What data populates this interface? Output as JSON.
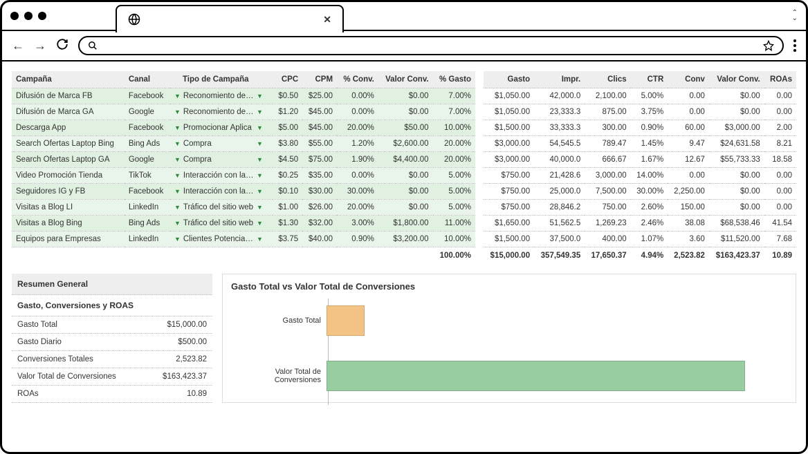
{
  "table1": {
    "headers": [
      "Campaña",
      "Canal",
      "Tipo de Campaña",
      "CPC",
      "CPM",
      "% Conv.",
      "Valor Conv.",
      "% Gasto"
    ],
    "rows": [
      {
        "campana": "Difusión de Marca FB",
        "canal": "Facebook",
        "tipo": "Reconomiento de M",
        "cpc": "$0.50",
        "cpm": "$25.00",
        "pconv": "0.00%",
        "vconv": "$0.00",
        "pgasto": "7.00%"
      },
      {
        "campana": "Difusión de Marca GA",
        "canal": "Google",
        "tipo": "Reconomiento de M",
        "cpc": "$1.20",
        "cpm": "$45.00",
        "pconv": "0.00%",
        "vconv": "$0.00",
        "pgasto": "7.00%"
      },
      {
        "campana": "Descarga App",
        "canal": "Facebook",
        "tipo": "Promocionar Aplica",
        "cpc": "$5.00",
        "cpm": "$45.00",
        "pconv": "20.00%",
        "vconv": "$50.00",
        "pgasto": "10.00%"
      },
      {
        "campana": "Search Ofertas Laptop Bing",
        "canal": "Bing Ads",
        "tipo": "Compra",
        "cpc": "$3.80",
        "cpm": "$55.00",
        "pconv": "1.20%",
        "vconv": "$2,600.00",
        "pgasto": "20.00%"
      },
      {
        "campana": "Search Ofertas Laptop GA",
        "canal": "Google",
        "tipo": "Compra",
        "cpc": "$4.50",
        "cpm": "$75.00",
        "pconv": "1.90%",
        "vconv": "$4,400.00",
        "pgasto": "20.00%"
      },
      {
        "campana": "Video Promoción Tienda",
        "canal": "TikTok",
        "tipo": "Interacción con la Pu",
        "cpc": "$0.25",
        "cpm": "$35.00",
        "pconv": "0.00%",
        "vconv": "$0.00",
        "pgasto": "5.00%"
      },
      {
        "campana": "Seguidores IG y FB",
        "canal": "Facebook",
        "tipo": "Interacción con la Pu",
        "cpc": "$0.10",
        "cpm": "$30.00",
        "pconv": "30.00%",
        "vconv": "$0.00",
        "pgasto": "5.00%"
      },
      {
        "campana": "Visitas a Blog LI",
        "canal": "LinkedIn",
        "tipo": "Tráfico del sitio web",
        "cpc": "$1.00",
        "cpm": "$26.00",
        "pconv": "20.00%",
        "vconv": "$0.00",
        "pgasto": "5.00%"
      },
      {
        "campana": "Visitas a Blog Bing",
        "canal": "Bing Ads",
        "tipo": "Tráfico del sitio web",
        "cpc": "$1.30",
        "cpm": "$32.00",
        "pconv": "3.00%",
        "vconv": "$1,800.00",
        "pgasto": "11.00%"
      },
      {
        "campana": "Equipos para Empresas",
        "canal": "LinkedIn",
        "tipo": "Clientes Potenciales",
        "cpc": "$3.75",
        "cpm": "$40.00",
        "pconv": "0.90%",
        "vconv": "$3,200.00",
        "pgasto": "10.00%"
      }
    ],
    "footer_pgasto": "100.00%"
  },
  "table2": {
    "headers": [
      "Gasto",
      "Impr.",
      "Clics",
      "CTR",
      "Conv",
      "Valor Conv.",
      "ROAs"
    ],
    "rows": [
      {
        "gasto": "$1,050.00",
        "impr": "42,000.0",
        "clics": "2,100.00",
        "ctr": "5.00%",
        "conv": "0.00",
        "vconv": "$0.00",
        "roas": "0.00"
      },
      {
        "gasto": "$1,050.00",
        "impr": "23,333.3",
        "clics": "875.00",
        "ctr": "3.75%",
        "conv": "0.00",
        "vconv": "$0.00",
        "roas": "0.00"
      },
      {
        "gasto": "$1,500.00",
        "impr": "33,333.3",
        "clics": "300.00",
        "ctr": "0.90%",
        "conv": "60.00",
        "vconv": "$3,000.00",
        "roas": "2.00"
      },
      {
        "gasto": "$3,000.00",
        "impr": "54,545.5",
        "clics": "789.47",
        "ctr": "1.45%",
        "conv": "9.47",
        "vconv": "$24,631.58",
        "roas": "8.21"
      },
      {
        "gasto": "$3,000.00",
        "impr": "40,000.0",
        "clics": "666.67",
        "ctr": "1.67%",
        "conv": "12.67",
        "vconv": "$55,733.33",
        "roas": "18.58"
      },
      {
        "gasto": "$750.00",
        "impr": "21,428.6",
        "clics": "3,000.00",
        "ctr": "14.00%",
        "conv": "0.00",
        "vconv": "$0.00",
        "roas": "0.00"
      },
      {
        "gasto": "$750.00",
        "impr": "25,000.0",
        "clics": "7,500.00",
        "ctr": "30.00%",
        "conv": "2,250.00",
        "vconv": "$0.00",
        "roas": "0.00"
      },
      {
        "gasto": "$750.00",
        "impr": "28,846.2",
        "clics": "750.00",
        "ctr": "2.60%",
        "conv": "150.00",
        "vconv": "$0.00",
        "roas": "0.00"
      },
      {
        "gasto": "$1,650.00",
        "impr": "51,562.5",
        "clics": "1,269.23",
        "ctr": "2.46%",
        "conv": "38.08",
        "vconv": "$68,538.46",
        "roas": "41.54"
      },
      {
        "gasto": "$1,500.00",
        "impr": "37,500.0",
        "clics": "400.00",
        "ctr": "1.07%",
        "conv": "3.60",
        "vconv": "$11,520.00",
        "roas": "7.68"
      }
    ],
    "footer": {
      "gasto": "$15,000.00",
      "impr": "357,549.35",
      "clics": "17,650.37",
      "ctr": "4.94%",
      "conv": "2,523.82",
      "vconv": "$163,423.37",
      "roas": "10.89"
    }
  },
  "summary": {
    "title": "Resumen General",
    "subtitle": "Gasto, Conversiones y ROAS",
    "rows": [
      {
        "label": "Gasto Total",
        "value": "$15,000.00"
      },
      {
        "label": "Gasto Diario",
        "value": "$500.00"
      },
      {
        "label": "Conversiones Totales",
        "value": "2,523.82"
      },
      {
        "label": "Valor Total de Conversiones",
        "value": "$163,423.37"
      },
      {
        "label": "ROAs",
        "value": "10.89"
      }
    ]
  },
  "chart": {
    "title": "Gasto Total vs Valor Total de Conversiones"
  },
  "chart_data": {
    "type": "bar",
    "orientation": "horizontal",
    "categories": [
      "Gasto Total",
      "Valor Total de Conversiones"
    ],
    "values": [
      15000,
      163423.37
    ],
    "colors": [
      "#f2c384",
      "#97cda0"
    ],
    "xlim": [
      0,
      180000
    ],
    "title": "Gasto Total vs Valor Total de Conversiones"
  }
}
